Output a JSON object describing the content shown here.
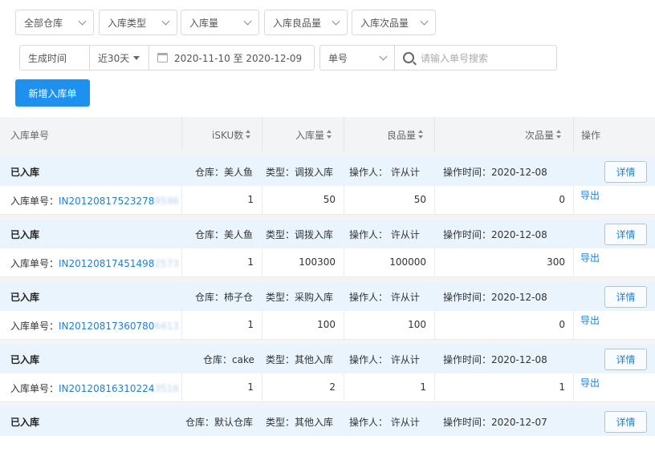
{
  "filters": {
    "warehouse": "全部仓库",
    "inbound_type": "入库类型",
    "inbound_qty": "入库量",
    "good_qty": "入库良品量",
    "defect_qty": "入库次品量",
    "time_label": "生成时间",
    "time_range": "近30天",
    "date_range": "2020-11-10 至 2020-12-09",
    "search_field": "单号",
    "search_placeholder": "请输入单号搜索"
  },
  "actions": {
    "add_inbound": "新增入库单"
  },
  "table": {
    "headers": {
      "order_no": "入库单号",
      "sku": "iSKU数",
      "inbound": "入库量",
      "good": "良品量",
      "defect": "次品量",
      "ops": "操作"
    }
  },
  "records": [
    {
      "status": "已入库",
      "warehouse": "仓库：美人鱼",
      "type": "类型：调拨入库",
      "operator": "操作人： 许从计",
      "op_time": "操作时间：2020-12-08",
      "order_label": "入库单号：",
      "order_no": "IN20120817523278",
      "order_suffix": "9596",
      "sku": "1",
      "inbound": "50",
      "good": "50",
      "defect": "0",
      "detail": "详情",
      "export": "导出"
    },
    {
      "status": "已入库",
      "warehouse": "仓库：美人鱼",
      "type": "类型：调拨入库",
      "operator": "操作人： 许从计",
      "op_time": "操作时间：2020-12-08",
      "order_label": "入库单号：",
      "order_no": "IN20120817451498",
      "order_suffix": "2573",
      "sku": "1",
      "inbound": "100300",
      "good": "100000",
      "defect": "300",
      "detail": "详情",
      "export": "导出"
    },
    {
      "status": "已入库",
      "warehouse": "仓库：柿子仓",
      "type": "类型：采购入库",
      "operator": "操作人： 许从计",
      "op_time": "操作时间：2020-12-08",
      "order_label": "入库单号：",
      "order_no": "IN20120817360780",
      "order_suffix": "6413",
      "sku": "1",
      "inbound": "100",
      "good": "100",
      "defect": "0",
      "detail": "详情",
      "export": "导出"
    },
    {
      "status": "已入库",
      "warehouse": "仓库：cake",
      "type": "类型：其他入库",
      "operator": "操作人： 许从计",
      "op_time": "操作时间：2020-12-08",
      "order_label": "入库单号：",
      "order_no": "IN20120816310224",
      "order_suffix": "3516",
      "sku": "1",
      "inbound": "2",
      "good": "1",
      "defect": "1",
      "detail": "详情",
      "export": "导出"
    },
    {
      "status": "已入库",
      "warehouse": "仓库：默认仓库",
      "type": "类型：其他入库",
      "operator": "操作人： 许从计",
      "op_time": "操作时间：2020-12-07",
      "detail": "详情"
    }
  ]
}
